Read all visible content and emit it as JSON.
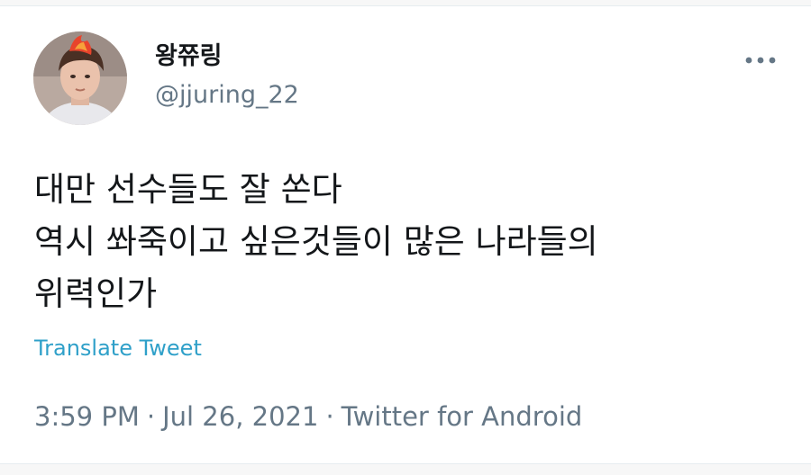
{
  "author": {
    "display_name": "왕쮸링",
    "handle": "@jjuring_22",
    "avatar_icon": "profile-photo"
  },
  "more_icon": "more-options-icon",
  "tweet": {
    "lines": [
      "대만 선수들도 잘 쏜다",
      "역시 쏴죽이고 싶은것들이 많은 나라들의",
      "위력인가"
    ],
    "translate_label": "Translate Tweet"
  },
  "meta": {
    "time": "3:59 PM",
    "separator": "·",
    "date": "Jul 26, 2021",
    "source": "Twitter for Android"
  },
  "colors": {
    "text": "#14171a",
    "secondary": "#657786",
    "link": "#2fa0c9"
  }
}
